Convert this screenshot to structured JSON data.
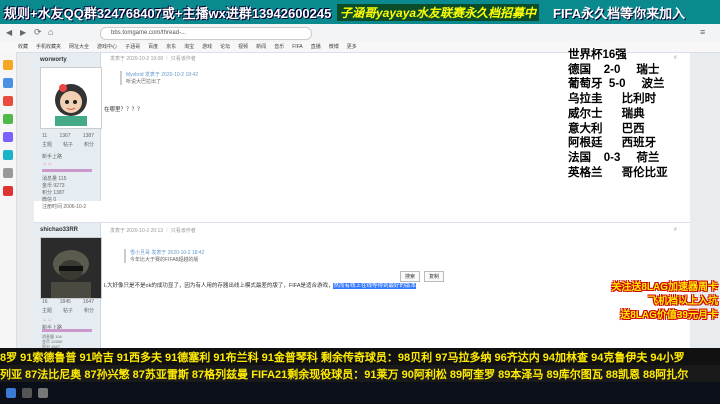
{
  "banner": {
    "left": "规则+水友QQ群324768407或+主播wx进群13942600245",
    "middle": "子涵哥yayaya水友联赛永久档招募中",
    "right": "FIFA永久档等你来加入"
  },
  "browser": {
    "url": "bbs.tomgame.com/thread-...",
    "bookmarks": [
      "收藏",
      "手机收藏夹",
      "网址大全",
      "游戏中心",
      "子涵哥",
      "百度",
      "京东",
      "淘宝",
      "游戏",
      "论坛",
      "视频",
      "新闻",
      "音乐",
      "FIFA",
      "直播",
      "微博",
      "更多"
    ]
  },
  "post1": {
    "username": "worworty",
    "stats_labels": [
      "主题",
      "帖子",
      "积分"
    ],
    "stats_values": [
      "11",
      "1367",
      "1387"
    ],
    "rank": "新手上路",
    "details": [
      "消息量  115",
      "金币  9273",
      "积分  1387",
      "微信  0",
      "注册时间  2006-10-2"
    ],
    "meta": "发表于 2020-10-2 19:08 ｜ 只看该作者",
    "quote_meta": "Myvbrid 发表于 2020-10-2 18:42",
    "quote_text": "听说大巴拉出了",
    "content": "在哪里？？？？"
  },
  "post2": {
    "username": "shichao33RR",
    "stats_labels": [
      "主题",
      "帖子",
      "积分"
    ],
    "stats_values": [
      "16",
      "1845",
      "1647"
    ],
    "rank": "新手上路",
    "details": [
      "消息量  104",
      "金币  12300",
      "积分  1647",
      "微信  0",
      "注册时间  2008-2-12"
    ],
    "meta": "发表于 2020-10-2 20:13 ｜ 只看该作者",
    "quote_meta": "雪小旦哥 发表于 2020-10-2 18:42",
    "quote_text": "今年比大于赛的FIFA8超越的版",
    "content": "L大好像只是不是ok的成功显了，因为有人用的存器出线上模式最差的版了，FIFA是适合游戏，",
    "highlight": "然而有线上在线等得到最好的版本",
    "button_search": "搜索",
    "button_copy": "复制"
  },
  "scores": {
    "title": "世界杯16强",
    "lines": [
      "德国    2-0     瑞士",
      "葡萄牙  5-0     波兰",
      "乌拉圭      比利时",
      "威尔士      瑞典",
      "意大利      巴西",
      "阿根廷      西班牙",
      "法国    0-3     荷兰",
      "英格兰      哥伦比亚"
    ]
  },
  "promo": [
    "关注送8LAG加速器周卡",
    "飞机档以上入坑",
    "送8LAG价值39元月卡"
  ],
  "ticker1": "8罗 91索德鲁普 91哈吉 91西多夫 91德塞利 91布兰科 91金普琴科 剩余传奇球员：98贝利 97马拉多纳 96齐达内 94加林查 94克鲁伊夫 94小罗",
  "ticker2": "列亚  87法比尼奥  87孙兴慜  87苏亚雷斯  87格列兹曼  FIFA21剩余现役球员：91莱万  90阿利松  89阿奎罗  89本泽马  89库尔图瓦  88凯恩  88阿扎尔",
  "colors": {
    "banner_bg": "#0a8a8f",
    "score_text": "#000000",
    "promo_text": "#ffeb00",
    "ticker_text": "#ffeb00",
    "highlight": "#3377ff"
  }
}
